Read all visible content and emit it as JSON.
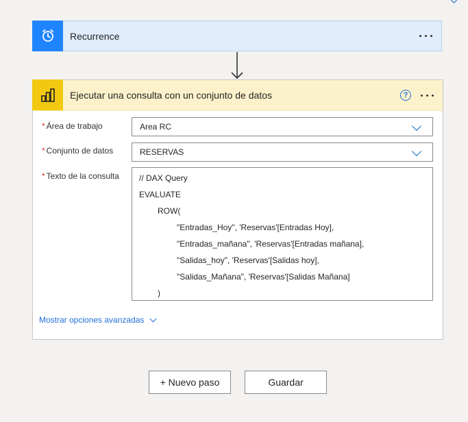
{
  "flow": {
    "trigger": {
      "title": "Recurrence",
      "icon": "alarm-clock-icon",
      "color": "#1f85ff"
    },
    "action": {
      "title": "Ejecutar una consulta con un conjunto de datos",
      "icon": "power-bi-icon",
      "color": "#f2c811",
      "help_glyph": "?",
      "fields": {
        "workspace": {
          "required_mark": "*",
          "label": "Área de trabajo",
          "value": "Area RC"
        },
        "dataset": {
          "required_mark": "*",
          "label": "Conjunto de datos",
          "value": "RESERVAS"
        },
        "query": {
          "required_mark": "*",
          "label": "Texto de la consulta",
          "lines": [
            "// DAX Query",
            "EVALUATE",
            "ROW(",
            "\"Entradas_Hoy\", 'Reservas'[Entradas Hoy],",
            "\"Entradas_mañana\", 'Reservas'[Entradas mañana],",
            "\"Salidas_hoy\", 'Reservas'[Salidas hoy],",
            "\"Salidas_Mañana\", 'Reservas'[Salidas Mañana]",
            ")"
          ]
        }
      },
      "advanced_link": "Mostrar opciones avanzadas"
    }
  },
  "buttons": {
    "new_step": "+ Nuevo paso",
    "save": "Guardar"
  }
}
